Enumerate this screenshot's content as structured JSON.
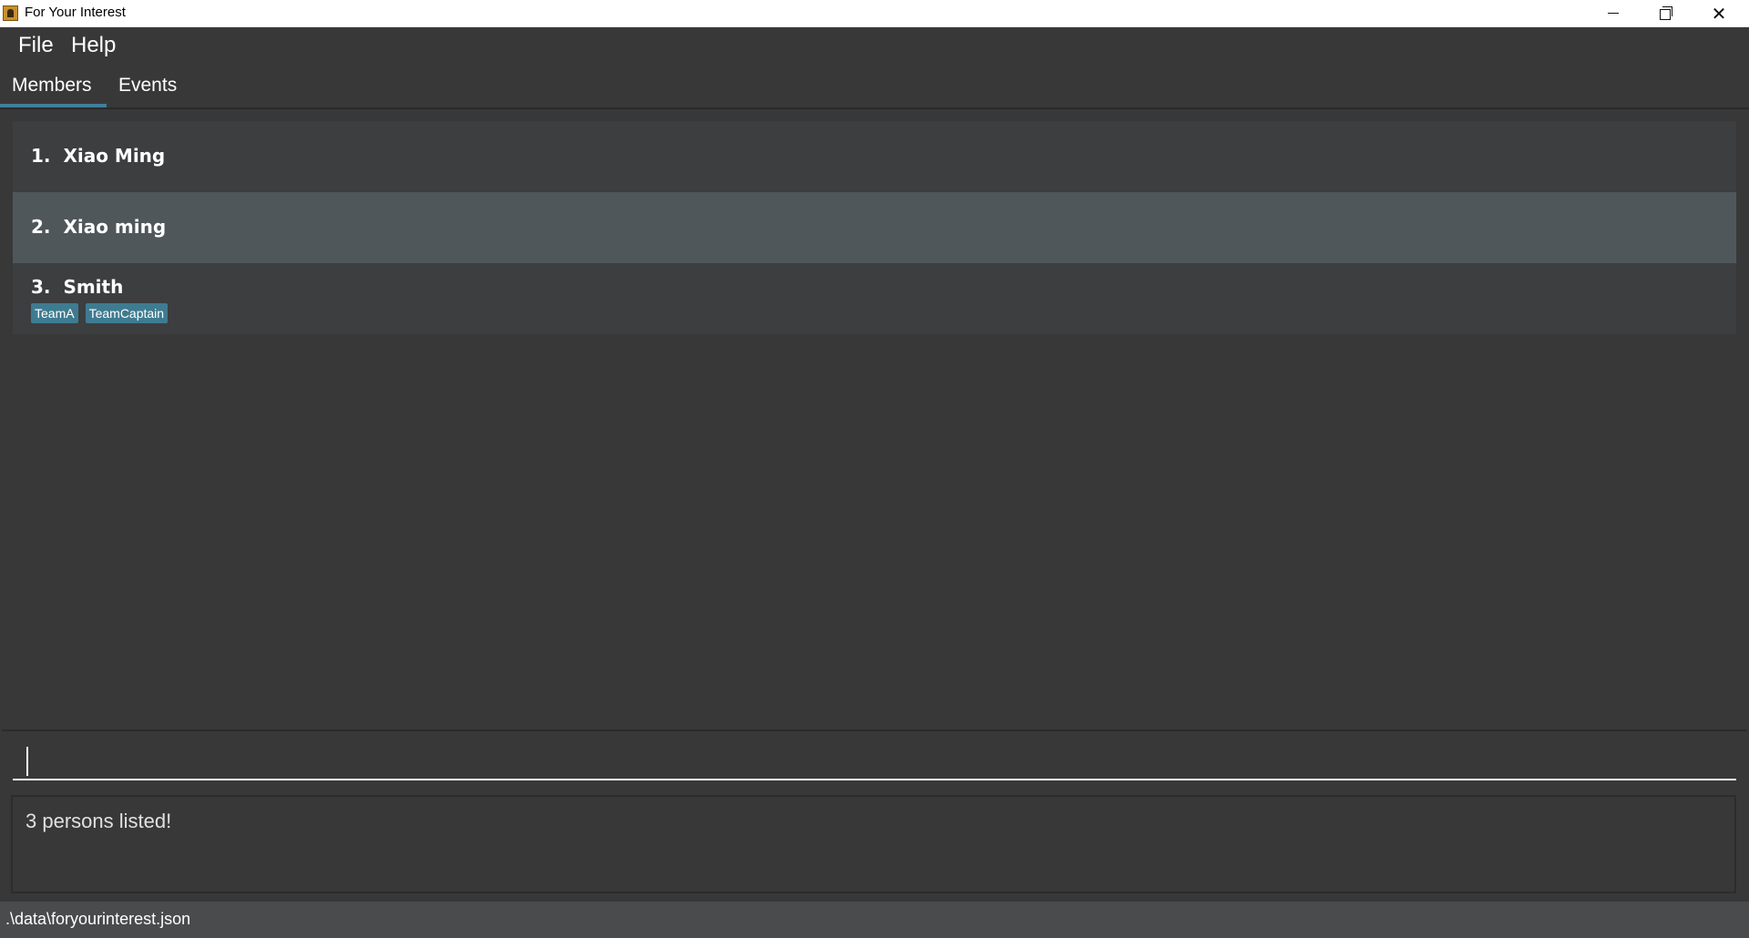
{
  "window": {
    "title": "For Your Interest",
    "minimize_icon": "minimize-icon",
    "maximize_icon": "restore-icon",
    "close_icon": "close-icon",
    "close_glyph": "✕"
  },
  "menu": {
    "items": [
      {
        "label": "File"
      },
      {
        "label": "Help"
      }
    ]
  },
  "tabs": {
    "items": [
      {
        "label": "Members",
        "selected": true
      },
      {
        "label": "Events",
        "selected": false
      }
    ],
    "accent_color": "#3f7f9a"
  },
  "members": {
    "items": [
      {
        "index_name": "1.  Xiao Ming",
        "tags": [],
        "selected": false
      },
      {
        "index_name": "2.  Xiao ming",
        "tags": [],
        "selected": true
      },
      {
        "index_name": "3.  Smith",
        "tags": [
          "TeamA",
          "TeamCaptain"
        ],
        "selected": false
      }
    ]
  },
  "command": {
    "value": "",
    "placeholder": ""
  },
  "result": {
    "message": "3 persons listed!"
  },
  "status": {
    "file_path": ".\\data\\foryourinterest.json"
  },
  "colors": {
    "background": "#383838",
    "card": "#3c3e40",
    "card_selected": "#4f575b",
    "tag": "#3e7b91"
  }
}
